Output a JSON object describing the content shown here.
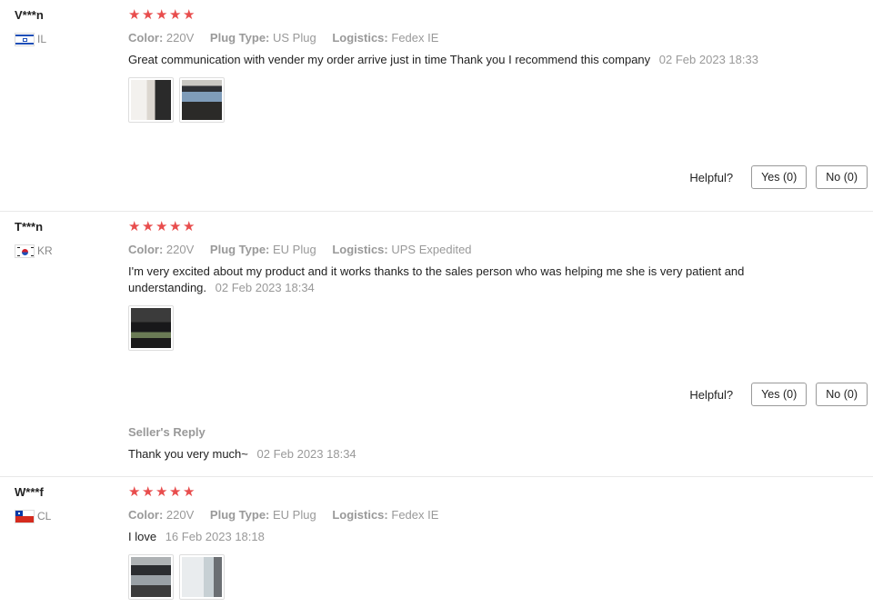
{
  "labels": {
    "color": "Color:",
    "plug_type": "Plug Type:",
    "logistics": "Logistics:",
    "helpful": "Helpful?",
    "seller_reply": "Seller's Reply"
  },
  "colors": {
    "star": "#e84d4d",
    "muted": "#999999"
  },
  "reviews": [
    {
      "user": "V***n",
      "country": "IL",
      "rating": 5,
      "color": "220V",
      "plug_type": "US Plug",
      "logistics": "Fedex IE",
      "text": "Great communication with vender my order arrive just in time Thank you I recommend this company",
      "date": "02 Feb 2023 18:33",
      "yes": "Yes (0)",
      "no": "No (0)"
    },
    {
      "user": "T***n",
      "country": "KR",
      "rating": 5,
      "color": "220V",
      "plug_type": "EU Plug",
      "logistics": "UPS Expedited",
      "text": "I'm very excited about my product and it works thanks to the sales person who was helping me she is very patient and understanding.",
      "date": "02 Feb 2023 18:34",
      "yes": "Yes (0)",
      "no": "No (0)",
      "reply": {
        "text": "Thank you very much~",
        "date": "02 Feb 2023 18:34"
      }
    },
    {
      "user": "W***f",
      "country": "CL",
      "rating": 5,
      "color": "220V",
      "plug_type": "EU Plug",
      "logistics": "Fedex IE",
      "text": "I love",
      "date": "16 Feb 2023 18:18"
    }
  ]
}
